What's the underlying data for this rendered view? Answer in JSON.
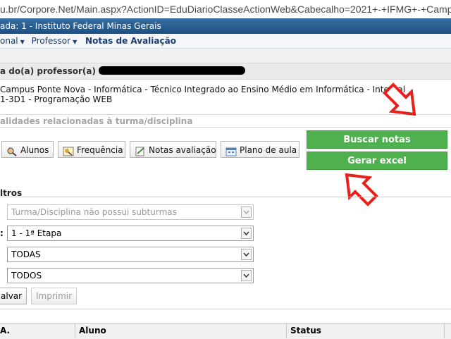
{
  "browser": {
    "url": "u.br/Corpore.Net/Main.aspx?ActionID=EduDiarioClasseActionWeb&Cabecalho=2021+-+IFMG+-+Camp"
  },
  "banner": {
    "text": "ada: 1 - Instituto Federal Minas Gerais"
  },
  "nav": {
    "items": [
      "onal",
      "Professor"
    ],
    "current": "Notas de Avaliação"
  },
  "professor": {
    "label": "a do(a) professor(a) Lu"
  },
  "course": {
    "line1": "Campus Ponte Nova - Informática - Técnico Integrado ao Ensino Médio em Informática - Integral",
    "line2": "1-3D1 - Programação WEB"
  },
  "functions_label": "alidades relacionadas à turma/disciplina",
  "toolbar": {
    "alunos": "Alunos",
    "frequencia": "Frequência",
    "notas": "Notas avaliação",
    "plano": "Plano de aula"
  },
  "actions": {
    "buscar": "Buscar notas",
    "excel": "Gerar excel"
  },
  "filters": {
    "title": "ltros",
    "colon": ":",
    "subturma": "Turma/Disciplina não possui subturmas",
    "etapa": "1 - 1ª Etapa",
    "select3": "TODAS",
    "select4": "TODOS"
  },
  "buttons": {
    "salvar": "alvar",
    "imprimir": "Imprimir"
  },
  "table": {
    "headers": [
      "A.",
      "Aluno",
      "Status"
    ]
  },
  "colors": {
    "banner": "#1d4f82",
    "green": "#4fb04e",
    "arrow": "#e8201c"
  }
}
